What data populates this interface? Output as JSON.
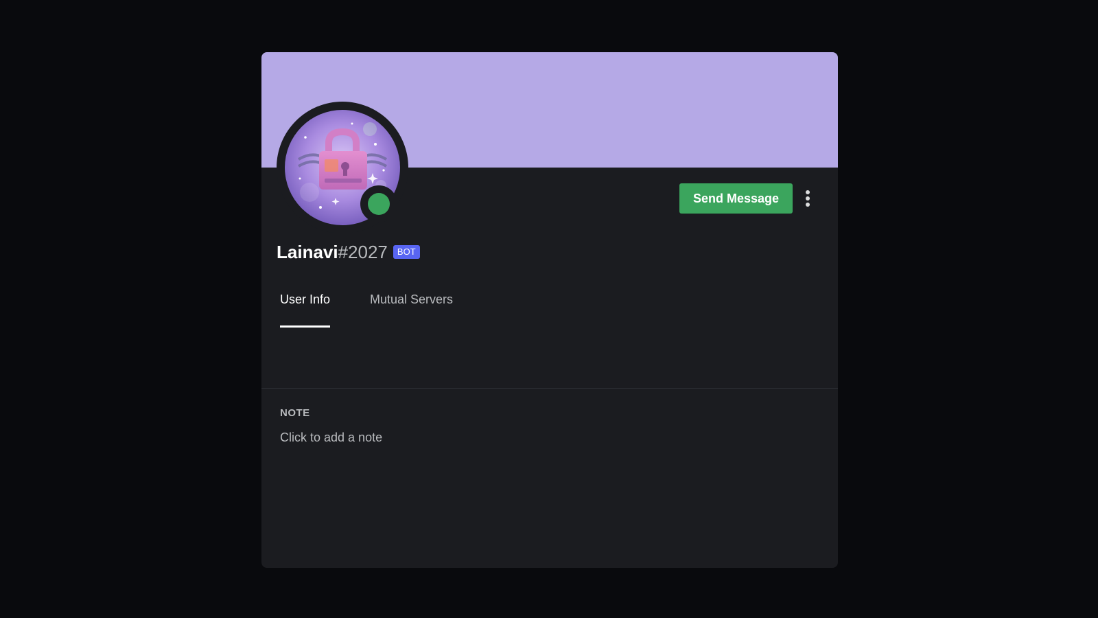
{
  "profile": {
    "username": "Lainavi",
    "discriminator": "#2027",
    "bot_tag": "BOT",
    "status": "online",
    "avatar_icon": "padlock-avatar-icon"
  },
  "actions": {
    "send_message_label": "Send Message",
    "more_icon": "more-vertical-icon"
  },
  "tabs": [
    {
      "label": "User Info",
      "active": true
    },
    {
      "label": "Mutual Servers",
      "active": false
    }
  ],
  "note": {
    "title": "NOTE",
    "placeholder": "Click to add a note",
    "value": ""
  },
  "colors": {
    "banner": "#b5a9e6",
    "card_bg": "#1b1c20",
    "page_bg": "#090a0d",
    "send_button": "#3ba55d",
    "status_online": "#3ba55d",
    "bot_tag": "#5865f2"
  }
}
